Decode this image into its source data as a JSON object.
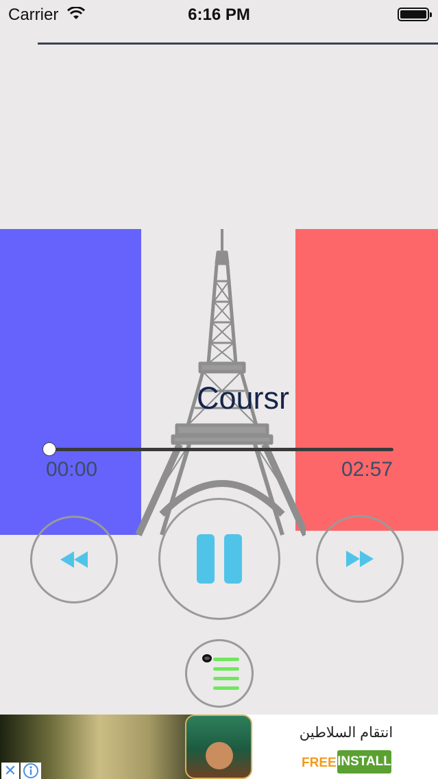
{
  "status_bar": {
    "carrier": "Carrier",
    "time": "6:16 PM",
    "wifi_icon": "wifi-icon",
    "battery_icon": "battery-icon"
  },
  "player": {
    "track_title": "Coursr",
    "elapsed": "00:00",
    "total": "02:57",
    "progress": 0,
    "accent_color": "#4fc4e8",
    "playlist_color": "#6ee85a",
    "flag_colors": {
      "blue": "#6563fb",
      "white": "#ebe9ea",
      "red": "#fd6769"
    },
    "background_image_icon": "eiffel-tower-icon",
    "controls": {
      "rewind_icon": "rewind-icon",
      "pause_icon": "pause-icon",
      "forward_icon": "fast-forward-icon",
      "playlist_icon": "playlist-icon"
    }
  },
  "ad": {
    "title": "انتقام السلاطين",
    "free_label": "FREE",
    "install_label": "INSTALL",
    "close_icon": "close-icon",
    "info_icon": "info-icon",
    "install_color": "#5ba132",
    "free_color": "#f29a1a"
  }
}
